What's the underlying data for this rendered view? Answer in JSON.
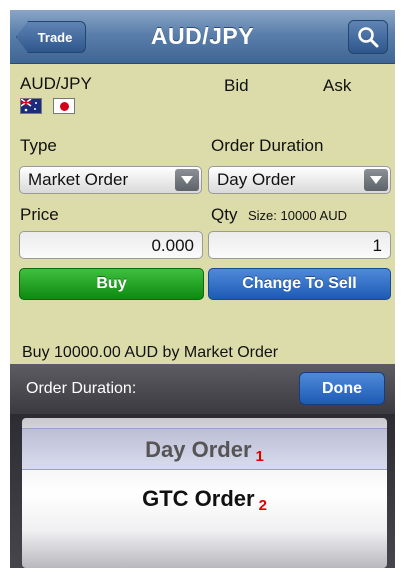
{
  "navbar": {
    "back_label": "Trade",
    "title": "AUD/JPY",
    "search_icon": "search-icon"
  },
  "quote": {
    "pair": "AUD/JPY",
    "bid_label": "Bid",
    "ask_label": "Ask",
    "base_flag": "flag-australia-icon",
    "quote_flag": "flag-japan-icon"
  },
  "order_form": {
    "type_label": "Type",
    "type_value": "Market Order",
    "duration_label": "Order Duration",
    "duration_value": "Day Order",
    "price_label": "Price",
    "price_value": "0.000",
    "qty_label": "Qty",
    "qty_size": "Size: 10000 AUD",
    "qty_value": "1",
    "buy_label": "Buy",
    "sell_label": "Change To Sell",
    "summary": "Buy 10000.00 AUD by Market Order"
  },
  "picker": {
    "label": "Order Duration:",
    "done_label": "Done",
    "options": [
      {
        "label": "Day Order",
        "marker": "1"
      },
      {
        "label": "GTC Order",
        "marker": "2"
      }
    ]
  },
  "colors": {
    "panel": "#dcdcaa",
    "buy": "#0d8a10",
    "sell": "#1e5ab4",
    "marker": "#e00000"
  }
}
